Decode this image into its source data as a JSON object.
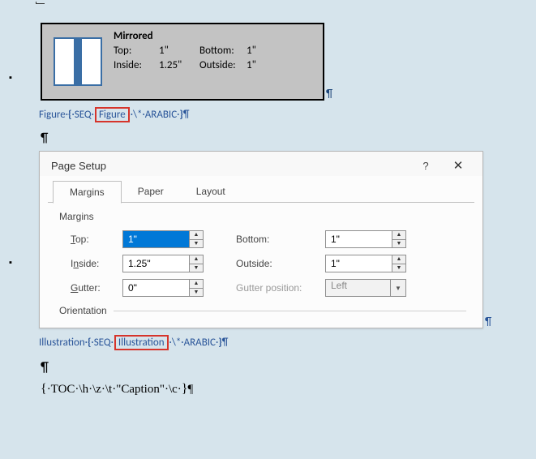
{
  "mirrored": {
    "title": "Mirrored",
    "top_label": "Top:",
    "top_val": "1\"",
    "inside_label": "Inside:",
    "inside_val": "1.25\"",
    "bottom_label": "Bottom:",
    "bottom_val": "1\"",
    "outside_label": "Outside:",
    "outside_val": "1\""
  },
  "caption1": {
    "prefix": "Figure·",
    "brace_open": "{",
    "seq": "·SEQ·",
    "highlighted": "Figure",
    "arabic": "·\\*·ARABIC·",
    "brace_close": "}",
    "para": "¶"
  },
  "blank1": "¶",
  "dialog": {
    "title": "Page Setup",
    "help": "?",
    "close": "✕",
    "tabs": [
      "Margins",
      "Paper",
      "Layout"
    ],
    "section1": "Margins",
    "top_label_pre": "T",
    "top_label_post": "op:",
    "top_val": "1\"",
    "bottom_label_pre": "B",
    "bottom_label_post": "ottom:",
    "bottom_val": "1\"",
    "inside_label_pre": "I",
    "inside_label_mid": "n",
    "inside_label_post": "side:",
    "inside_val": "1.25\"",
    "outside_label_pre": "O",
    "outside_label_mid": "u",
    "outside_label_post": "tside:",
    "outside_val": "1\"",
    "gutter_label_pre": "G",
    "gutter_label_post": "utter:",
    "gutter_val": "0\"",
    "gutterpos_label": "Gutter position:",
    "gutterpos_val": "Left",
    "orientation": "Orientation"
  },
  "caption2": {
    "prefix": "Illustration·",
    "brace_open": "{",
    "seq": "·SEQ·",
    "highlighted": "Illustration",
    "arabic": "·\\*·ARABIC·",
    "brace_close": "}",
    "para": "¶"
  },
  "blank2": "¶",
  "toc": {
    "brace_open": "{",
    "text": "·TOC·\\h·\\z·\\t·\"Caption\"·\\c·",
    "brace_close": "}",
    "para": "¶"
  }
}
